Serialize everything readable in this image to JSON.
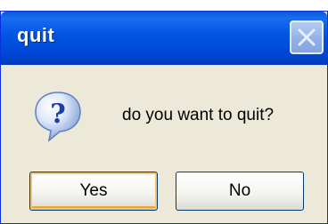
{
  "dialog": {
    "title": "quit",
    "message": "do you want to quit?",
    "icon": "question-icon",
    "buttons": {
      "yes_label": "Yes",
      "no_label": "No"
    },
    "colors": {
      "titlebar": "#0054e3",
      "body": "#ece9d8",
      "default_focus": "#f4c571"
    }
  }
}
